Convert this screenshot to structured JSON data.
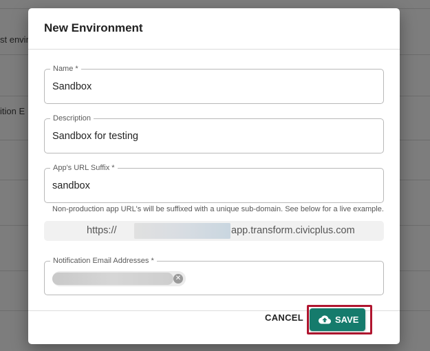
{
  "background": {
    "row_texts": [
      "st envir",
      "ition E"
    ]
  },
  "dialog": {
    "title": "New Environment",
    "fields": {
      "name": {
        "label": "Name *",
        "value": "Sandbox"
      },
      "description": {
        "label": "Description",
        "value": "Sandbox for testing"
      },
      "url_suffix": {
        "label": "App's URL Suffix *",
        "value": "sandbox",
        "helper": "Non-production app URL's will be suffixed with a unique sub-domain. See below for a live example."
      },
      "url_preview": {
        "prefix": "https://",
        "suffix": "app.transform.civicplus.com"
      },
      "notification_emails": {
        "label": "Notification Email Addresses *"
      }
    },
    "actions": {
      "cancel_label": "CANCEL",
      "save_label": "SAVE"
    }
  },
  "colors": {
    "save_button": "#157b6c",
    "highlight_frame": "#b0152f"
  },
  "icons": {
    "save": "cloud-upload-icon",
    "chip_remove": "close-circle-icon"
  }
}
